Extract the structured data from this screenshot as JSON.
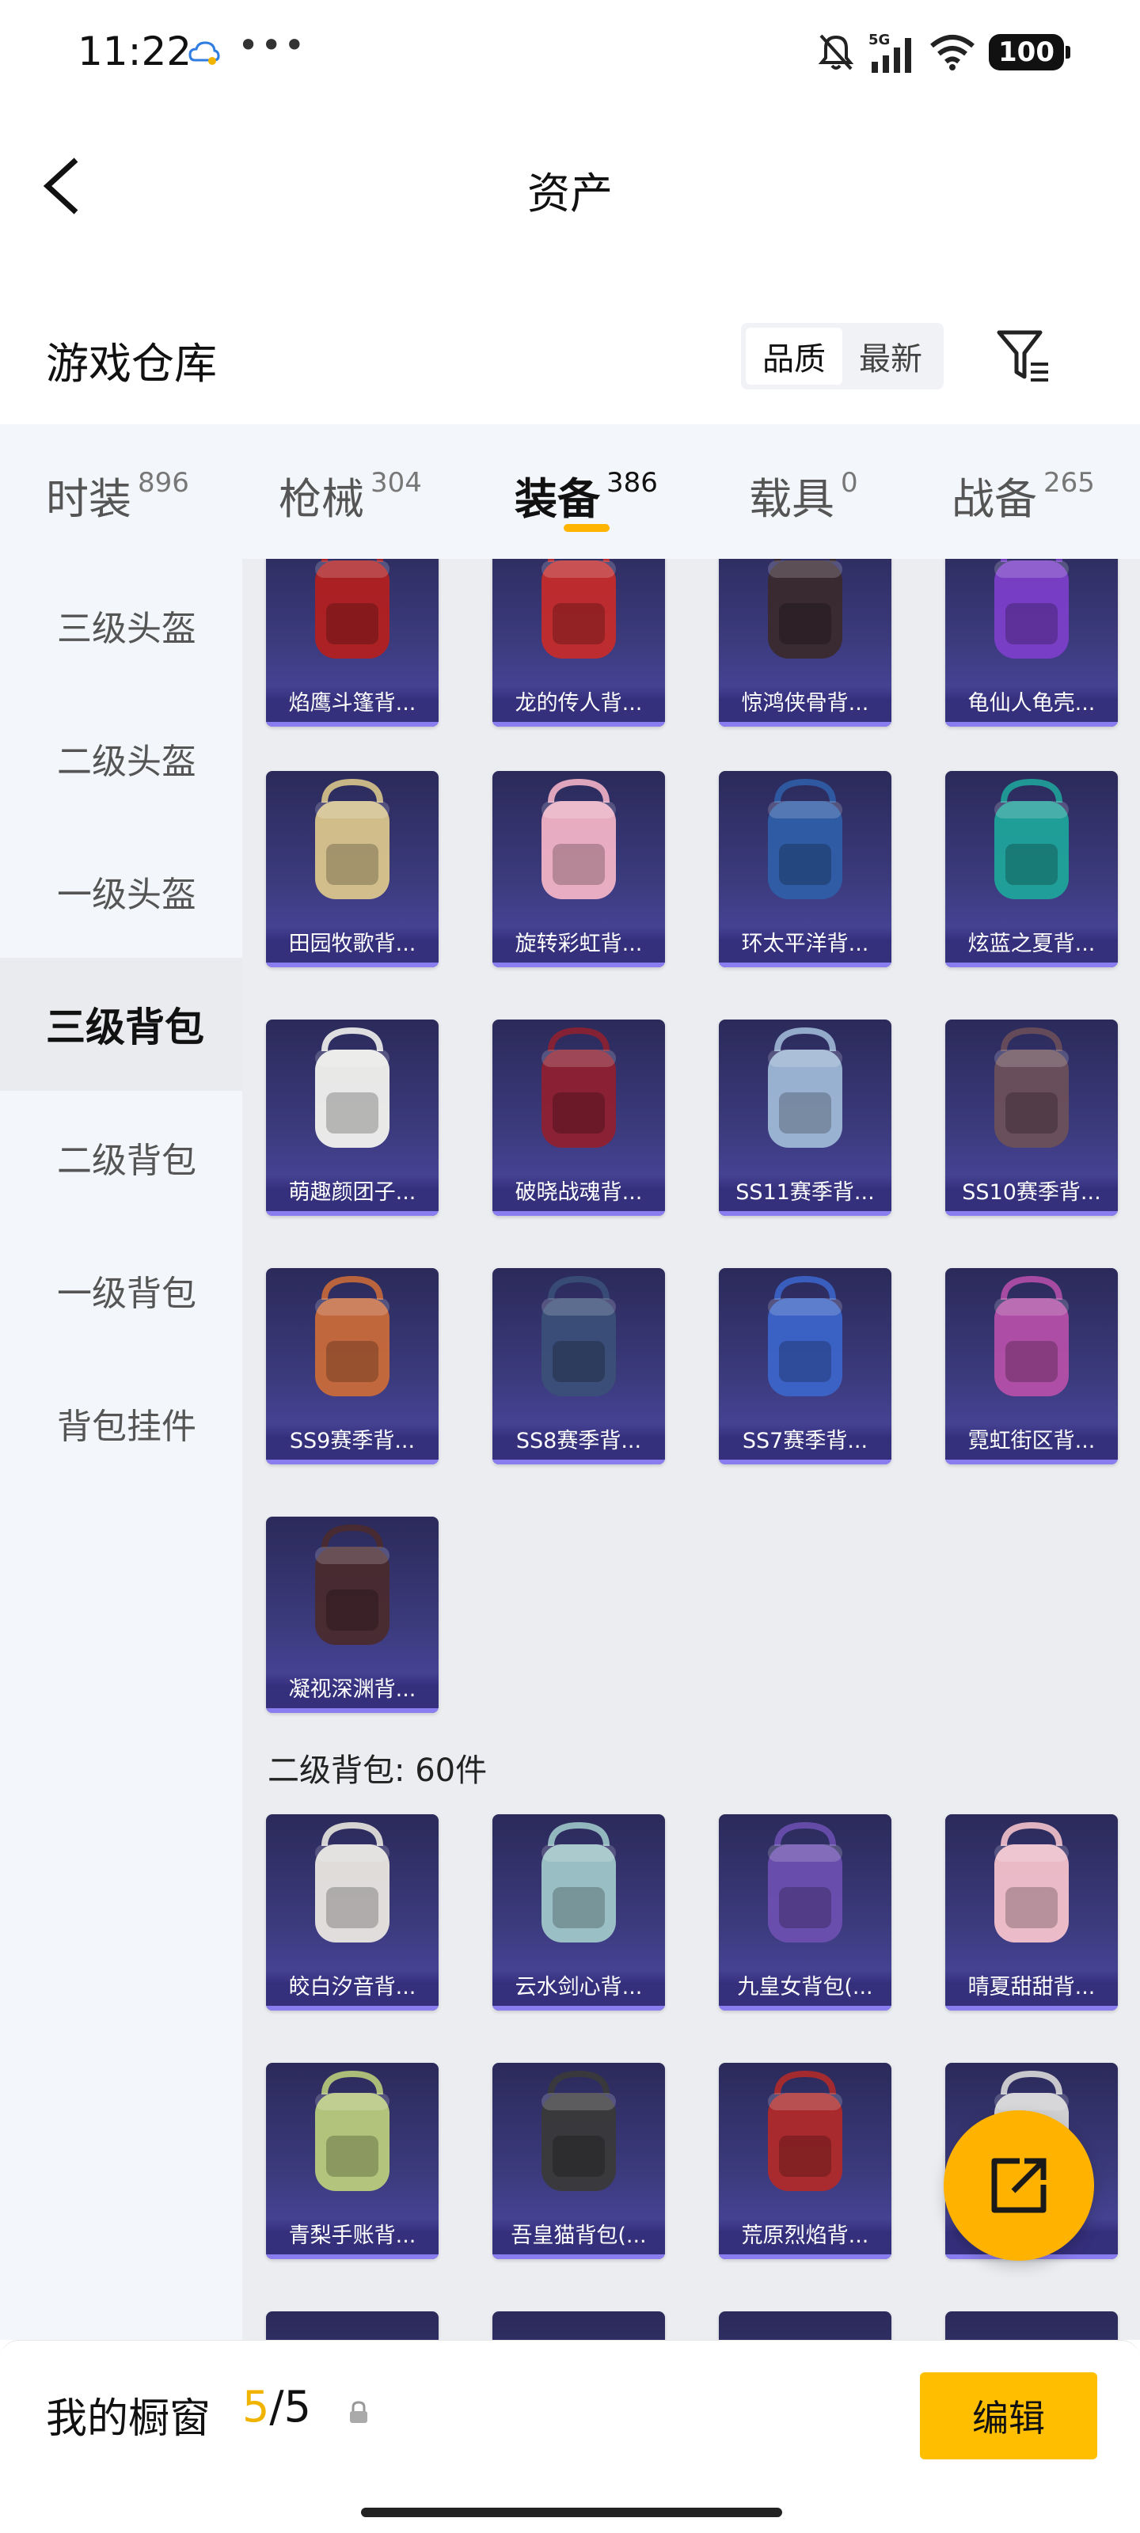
{
  "status_bar": {
    "time": "11:22",
    "dots": "•••",
    "battery": "100",
    "network": "5G"
  },
  "header": {
    "title": "资产",
    "back_icon": "chevron-left-icon"
  },
  "warehouse": {
    "title": "游戏仓库",
    "sort_options": [
      "品质",
      "最新"
    ],
    "active_sort": "品质"
  },
  "category_tabs": [
    {
      "label": "时装",
      "count": "896"
    },
    {
      "label": "枪械",
      "count": "304"
    },
    {
      "label": "装备",
      "count": "386",
      "active": true
    },
    {
      "label": "载具",
      "count": "0"
    },
    {
      "label": "战备",
      "count": "265"
    }
  ],
  "sidebar": {
    "items": [
      "三级头盔",
      "二级头盔",
      "一级头盔",
      "三级背包",
      "二级背包",
      "一级背包",
      "背包挂件"
    ],
    "active": "三级背包"
  },
  "level3_backpacks": [
    {
      "name": "焰鹰斗篷背...",
      "color": "#b22020"
    },
    {
      "name": "龙的传人背...",
      "color": "#c42b2b"
    },
    {
      "name": "惊鸿侠骨背...",
      "color": "#3a2a2e"
    },
    {
      "name": "龟仙人龟壳...",
      "color": "#7b3fc9"
    },
    {
      "name": "田园牧歌背...",
      "color": "#d9c58c"
    },
    {
      "name": "旋转彩虹背...",
      "color": "#f2b3c6"
    },
    {
      "name": "环太平洋背...",
      "color": "#2f5ea8"
    },
    {
      "name": "炫蓝之夏背...",
      "color": "#1fa39a"
    },
    {
      "name": "萌趣颜团子...",
      "color": "#f2f2ee"
    },
    {
      "name": "破晓战魂背...",
      "color": "#8e2030"
    },
    {
      "name": "SS11赛季背...",
      "color": "#9fb8d6"
    },
    {
      "name": "SS10赛季背...",
      "color": "#6b4f5a"
    },
    {
      "name": "SS9赛季背...",
      "color": "#c96a3a"
    },
    {
      "name": "SS8赛季背...",
      "color": "#3a4f78"
    },
    {
      "name": "SS7赛季背...",
      "color": "#3b64c8"
    },
    {
      "name": "霓虹街区背...",
      "color": "#b44fa8"
    },
    {
      "name": "凝视深渊背...",
      "color": "#4a2a2e"
    }
  ],
  "level2_group": {
    "title": "二级背包: 60件"
  },
  "level2_backpacks": [
    {
      "name": "皎白汐音背...",
      "color": "#e9e6e0"
    },
    {
      "name": "云水剑心背...",
      "color": "#9fc7c9"
    },
    {
      "name": "九皇女背包(...",
      "color": "#6b4fb0"
    },
    {
      "name": "晴夏甜甜背...",
      "color": "#f4c2cc"
    },
    {
      "name": "青梨手账背...",
      "color": "#b9cc7c"
    },
    {
      "name": "吾皇猫背包(...",
      "color": "#3a3a3a"
    },
    {
      "name": "荒原烈焰背...",
      "color": "#b02a2a"
    },
    {
      "name": "",
      "color": "#d8d8d8"
    }
  ],
  "bottom_bar": {
    "label": "我的橱窗",
    "current": "5",
    "separator": "/",
    "total": "5",
    "edit_label": "编辑"
  },
  "accent_color": "#ffb400"
}
